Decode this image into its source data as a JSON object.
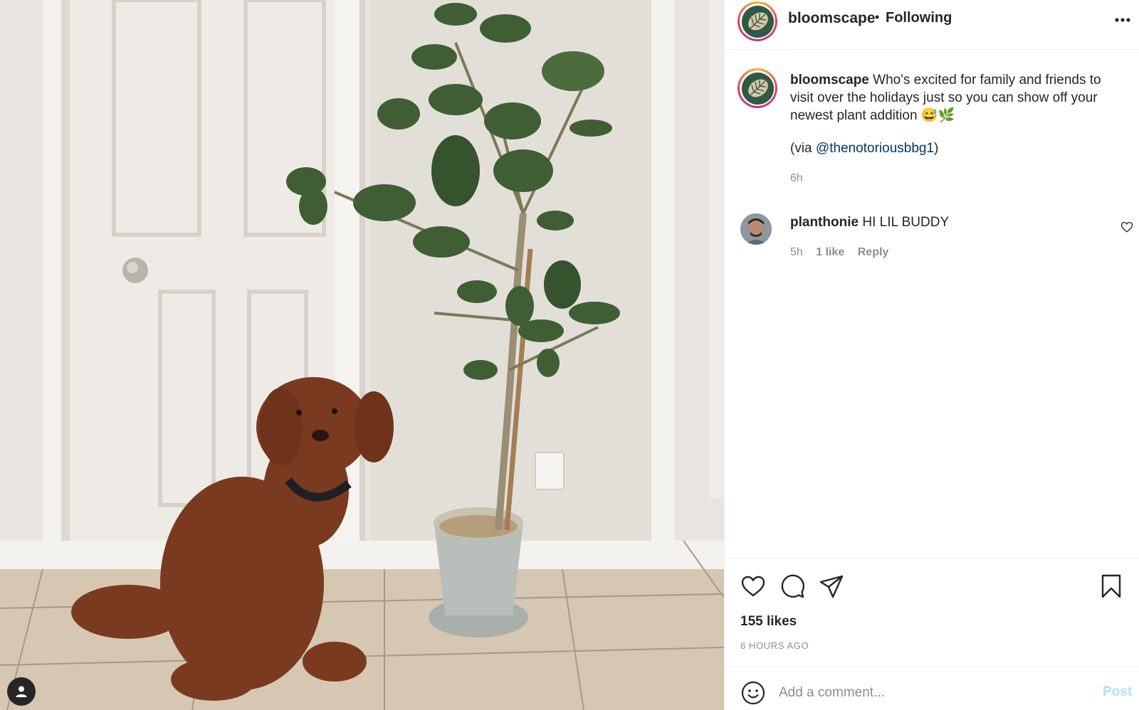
{
  "post": {
    "username": "bloomscape",
    "separator": "•",
    "follow_status": "Following",
    "more_icon": "more-horizontal-icon",
    "caption": {
      "username": "bloomscape",
      "text": "Who's excited for family and friends to visit over the holidays just so you can show off your newest plant addition 😅🌿",
      "via_prefix": "(via ",
      "mention": "@thenotoriousbbg1",
      "via_suffix": ")",
      "time": "6h"
    },
    "comments": [
      {
        "username": "planthonie",
        "text": "HI LIL BUDDY",
        "time": "5h",
        "likes": "1 like",
        "reply": "Reply"
      }
    ],
    "likes": "155 likes",
    "time_ago": "6 HOURS AGO",
    "add_comment": {
      "placeholder": "Add a comment...",
      "post_label": "Post"
    },
    "icons": {
      "like": "heart-icon",
      "comment": "comment-icon",
      "share": "paper-plane-icon",
      "save": "bookmark-icon",
      "emoji": "smiley-icon",
      "tagged_user": "user-icon"
    },
    "colors": {
      "link": "#00376b",
      "secondary_text": "#8e8e8e",
      "post_button_disabled": "#b2dffc",
      "primary_text": "#262626"
    }
  }
}
